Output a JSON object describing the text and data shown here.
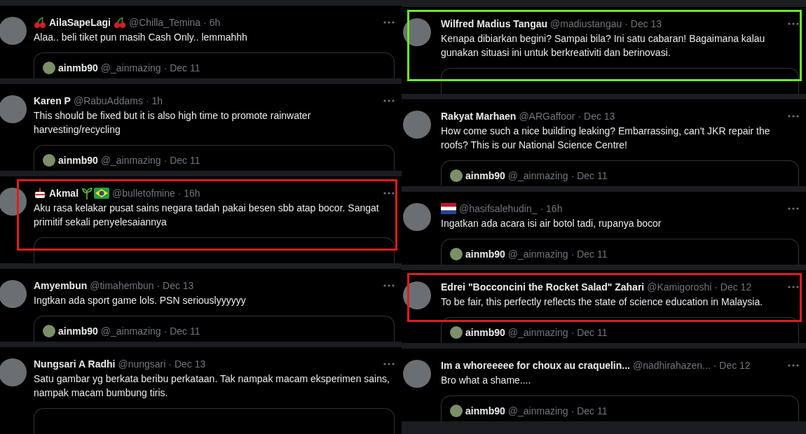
{
  "columns": [
    {
      "tweets": [
        {
          "author": "AilaSapeLagi",
          "badges_before": [
            {
              "kind": "cherry"
            }
          ],
          "badges_after": [
            {
              "kind": "cherry"
            }
          ],
          "handle": "@Chilla_Temina",
          "time": "· 6h",
          "text": "Alaa.. beli tiket pun masih Cash Only.. lemmahhh",
          "quote": {
            "author": "ainmb90",
            "handle": "@_ainmazing",
            "time": "· Dec 11"
          }
        },
        {
          "author": "Karen P",
          "handle": "@RabuAddams",
          "time": "· 1h",
          "text": "This should be fixed but it is also high time to promote rainwater harvesting/recycling",
          "quote": {
            "author": "ainmb90",
            "handle": "@_ainmazing",
            "time": "· Dec 11"
          }
        },
        {
          "author": "Akmal",
          "badges_before": [
            {
              "kind": "cake"
            }
          ],
          "badges_after": [
            {
              "kind": "sprout"
            },
            {
              "kind": "brazil"
            }
          ],
          "handle": "@bulletofmine",
          "time": "· 16h",
          "text": "Aku rasa kelakar pusat sains negara tadah pakai besen sbb atap bocor. Sangat primitif sekali penyelesaiannya",
          "color": "#e21b1b"
        },
        {
          "author": "Amyembun",
          "handle": "@timahembun",
          "time": "· Dec 13",
          "text": "Ingtkan ada sport game lols. PSN seriouslyyyyyy",
          "quote": {
            "author": "ainmb90",
            "handle": "@_ainmazing",
            "time": "· Dec 11"
          }
        },
        {
          "author": "Nungsari A Radhi",
          "handle": "@nungsari",
          "time": "· Dec 13",
          "text": "Satu gambar yg berkata beribu perkataan. Tak nampak macam eksperimen sains, nampak macam bumbung tiris."
        }
      ]
    },
    {
      "tweets": [
        {
          "author": "Wilfred Madius Tangau",
          "handle": "@madiustangau",
          "time": "· Dec 13",
          "text": "Kenapa dibiarkan begini? Sampai bila? Ini satu cabaran! Bagaimana kalau gunakan situasi ini untuk berkreativiti dan berinovasi.",
          "color": "#6fe82a"
        },
        {
          "author": "Rakyat Marhaen",
          "handle": "@ARGaffoor",
          "time": "· Dec 13",
          "text": "How come such a nice building leaking? Embarrassing, can't JKR repair the roofs? This is our National Science Centre!",
          "quote": {
            "author": "ainmb90",
            "handle": "@_ainmazing",
            "time": "· Dec 11"
          }
        },
        {
          "badges_before": [
            {
              "kind": "netherlands"
            }
          ],
          "handle": "@hasifsalehudin_",
          "time": "· 16h",
          "text": "Ingatkan ada acara isi air botol tadi, rupanya bocor",
          "quote": {
            "author": "ainmb90",
            "handle": "@_ainmazing",
            "time": "· Dec 11"
          }
        },
        {
          "author": "Edrei \"Bocconcini the Rocket Salad\" Zahari",
          "handle": "@Kamigoroshi",
          "time": "· Dec 12",
          "text": "To be fair, this perfectly reflects the state of science education in Malaysia.",
          "quote": {
            "author": "ainmb90",
            "handle": "@_ainmazing",
            "time": "· Dec 11"
          },
          "color": "#e21b1b"
        },
        {
          "author": "Im a whoreeeee for choux au craquelin...",
          "handle": "@nadhirahazen...",
          "time": "· Dec 12",
          "text": "Bro what a shame....",
          "quote": {
            "author": "ainmb90",
            "handle": "@_ainmazing",
            "time": "· Dec 11"
          }
        }
      ]
    }
  ]
}
